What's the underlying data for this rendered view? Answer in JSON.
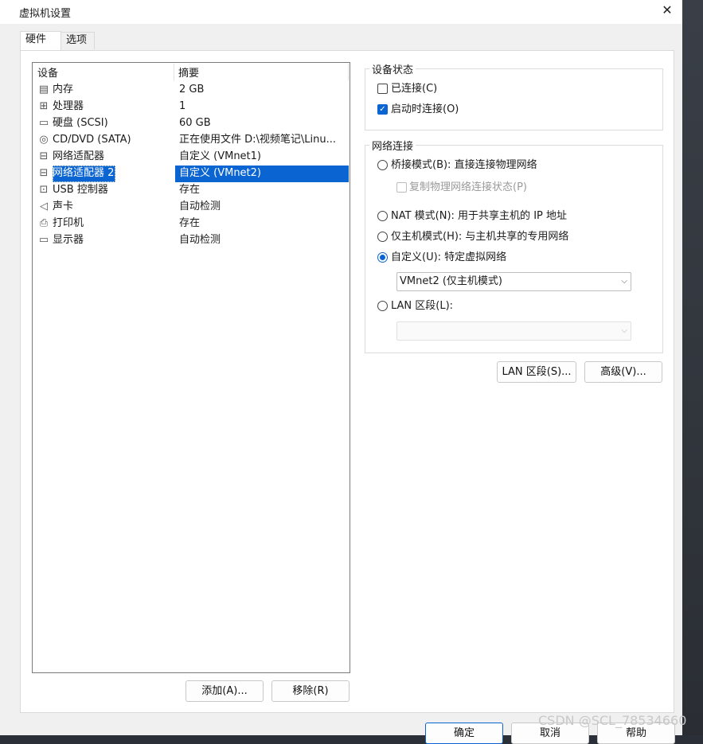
{
  "window": {
    "title": "虚拟机设置",
    "close_glyph": "✕"
  },
  "tabs": [
    {
      "label": "硬件"
    },
    {
      "label": "选项"
    }
  ],
  "device_list": {
    "col_device": "设备",
    "col_summary": "摘要",
    "items": [
      {
        "icon": "memory-icon",
        "glyph": "▤",
        "name": "内存",
        "summary": "2 GB"
      },
      {
        "icon": "cpu-icon",
        "glyph": "⊞",
        "name": "处理器",
        "summary": "1"
      },
      {
        "icon": "harddisk-icon",
        "glyph": "▭",
        "name": "硬盘 (SCSI)",
        "summary": "60 GB"
      },
      {
        "icon": "cd-dvd-icon",
        "glyph": "◎",
        "name": "CD/DVD (SATA)",
        "summary": "正在使用文件 D:\\视频笔记\\Linu..."
      },
      {
        "icon": "network-adapter-icon",
        "glyph": "⊟",
        "name": "网络适配器",
        "summary": "自定义 (VMnet1)"
      },
      {
        "icon": "network-adapter-icon",
        "glyph": "⊟",
        "name": "网络适配器 2",
        "summary": "自定义 (VMnet2)",
        "selected": true
      },
      {
        "icon": "usb-icon",
        "glyph": "⊡",
        "name": "USB 控制器",
        "summary": "存在"
      },
      {
        "icon": "sound-icon",
        "glyph": "◁",
        "name": "声卡",
        "summary": "自动检测"
      },
      {
        "icon": "printer-icon",
        "glyph": "⎙",
        "name": "打印机",
        "summary": "存在"
      },
      {
        "icon": "display-icon",
        "glyph": "▭",
        "name": "显示器",
        "summary": "自动检测"
      }
    ]
  },
  "list_buttons": {
    "add": "添加(A)...",
    "remove": "移除(R)"
  },
  "device_status": {
    "title": "设备状态",
    "connected": {
      "label": "已连接(C)",
      "checked": false
    },
    "connect_on_power": {
      "label": "启动时连接(O)",
      "checked": true
    },
    "check_glyph": "✓"
  },
  "network": {
    "title": "网络连接",
    "bridged": {
      "label": "桥接模式(B): 直接连接物理网络",
      "selected": false
    },
    "replicate": {
      "label": "复制物理网络连接状态(P)",
      "enabled": false
    },
    "nat": {
      "label": "NAT 模式(N): 用于共享主机的 IP 地址",
      "selected": false
    },
    "host_only": {
      "label": "仅主机模式(H): 与主机共享的专用网络",
      "selected": false
    },
    "custom": {
      "label": "自定义(U): 特定虚拟网络",
      "selected": true
    },
    "custom_select": "VMnet2 (仅主机模式)",
    "lan": {
      "label": "LAN 区段(L):",
      "selected": false
    },
    "lan_select": "",
    "chevron": "⌵"
  },
  "right_buttons": {
    "lan_segments": "LAN 区段(S)...",
    "advanced": "高级(V)..."
  },
  "footer_buttons": {
    "ok": "确定",
    "cancel": "取消",
    "help": "帮助"
  },
  "watermark": "CSDN @SCL_78534660"
}
